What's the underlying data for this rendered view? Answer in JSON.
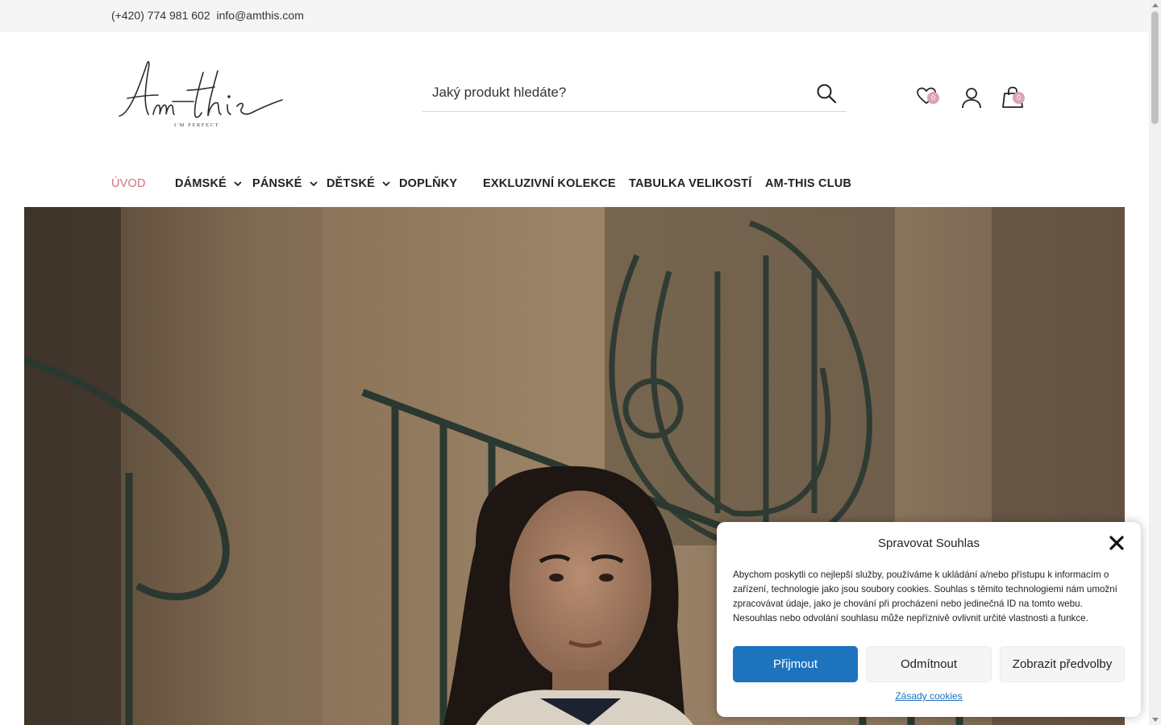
{
  "topbar": {
    "phone": "(+420) 774 981 602",
    "email": "info@amthis.com"
  },
  "logo": {
    "text": "Am-this",
    "tagline": "I'M PERFECT"
  },
  "search": {
    "placeholder": "Jaký produkt hledáte?"
  },
  "header_icons": {
    "wishlist_count": "0",
    "cart_count": "0",
    "badge_color": "#d9a3b0"
  },
  "nav": {
    "items": [
      {
        "label": "ÚVOD",
        "active": true
      },
      {
        "label": "DÁMSKÉ",
        "dropdown": true
      },
      {
        "label": "PÁNSKÉ",
        "dropdown": true
      },
      {
        "label": "DĚTSKÉ",
        "dropdown": true
      },
      {
        "label": "DOPLŇKY"
      },
      {
        "label": "EXKLUZIVNÍ KOLEKCE"
      },
      {
        "label": "TABULKA VELIKOSTÍ"
      },
      {
        "label": "AM-THIS CLUB"
      }
    ],
    "active_color": "#d66e7e"
  },
  "cookie": {
    "title": "Spravovat Souhlas",
    "text": "Abychom poskytli co nejlepší služby, používáme k ukládání a/nebo přístupu k informacím o zařízení, technologie jako jsou soubory cookies. Souhlas s těmito technologiemi nám umožní zpracovávat údaje, jako je chování při procházení nebo jedinečná ID na tomto webu. Nesouhlas nebo odvolání souhlasu může nepříznivě ovlivnit určité vlastnosti a funkce.",
    "accept_label": "Přijmout",
    "deny_label": "Odmítnout",
    "prefs_label": "Zobrazit předvolby",
    "policy_label": "Zásady cookies",
    "accent_color": "#1e73be"
  }
}
